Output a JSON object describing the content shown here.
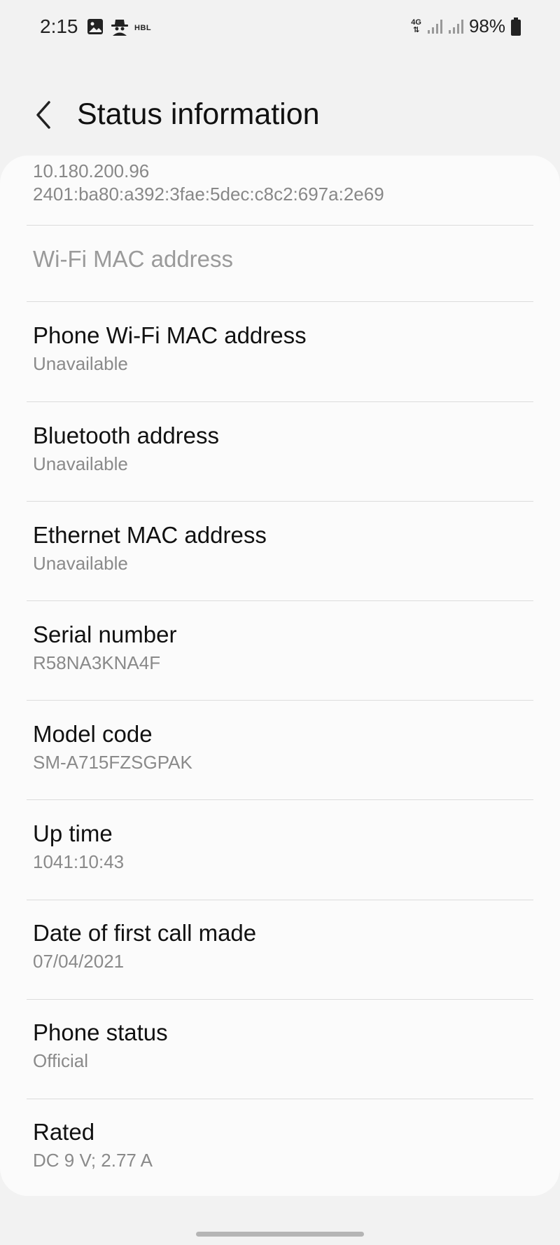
{
  "status_bar": {
    "time": "2:15",
    "carrier_label": "HBL",
    "network": "4G",
    "battery": "98%",
    "icons": [
      "image-icon",
      "spy-icon",
      "network-4g-icon",
      "signal-icon",
      "signal-icon",
      "battery-icon"
    ]
  },
  "header": {
    "back_icon": "chevron-left-icon",
    "title": "Status information"
  },
  "ip": {
    "ipv4": "10.180.200.96",
    "ipv6": "2401:ba80:a392:3fae:5dec:c8c2:697a:2e69"
  },
  "items": [
    {
      "title": "Wi-Fi MAC address",
      "value": ""
    },
    {
      "title": "Phone Wi-Fi MAC address",
      "value": "Unavailable"
    },
    {
      "title": "Bluetooth address",
      "value": "Unavailable"
    },
    {
      "title": "Ethernet MAC address",
      "value": "Unavailable"
    },
    {
      "title": "Serial number",
      "value": "R58NA3KNA4F"
    },
    {
      "title": "Model code",
      "value": "SM-A715FZSGPAK"
    },
    {
      "title": "Up time",
      "value": "1041:10:43"
    },
    {
      "title": "Date of first call made",
      "value": "07/04/2021"
    },
    {
      "title": "Phone status",
      "value": "Official"
    },
    {
      "title": "Rated",
      "value": "DC 9 V; 2.77 A"
    }
  ]
}
